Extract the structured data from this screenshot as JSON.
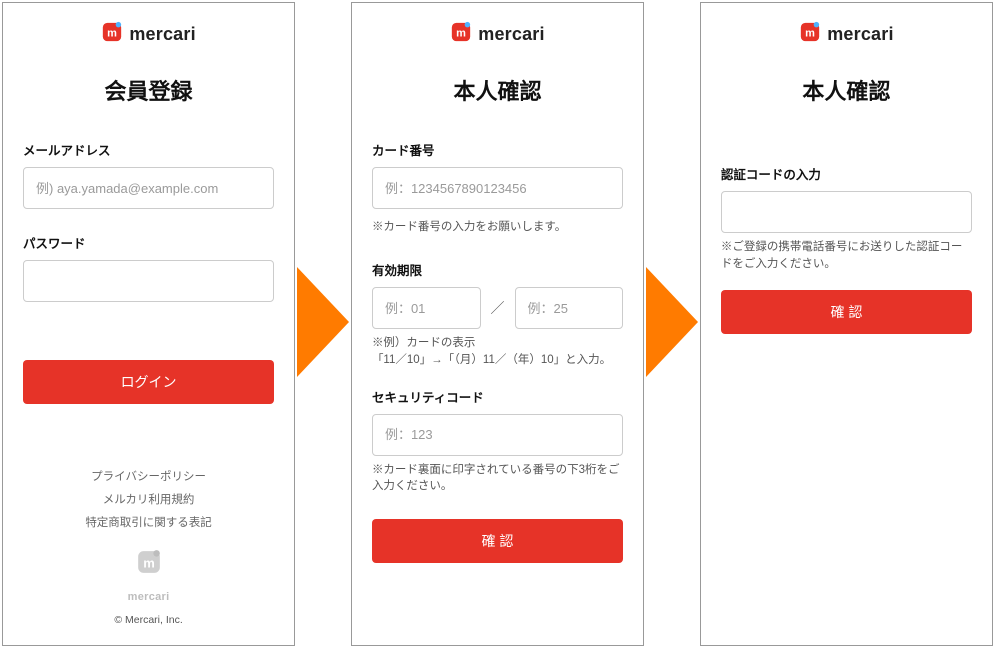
{
  "brand": {
    "name": "mercari"
  },
  "arrow_color": "#ff7b00",
  "accent": "#e63328",
  "panel1": {
    "heading": "会員登録",
    "email_label": "メールアドレス",
    "email_placeholder": "例) aya.yamada@example.com",
    "password_label": "パスワード",
    "login_btn": "ログイン",
    "links": {
      "privacy": "プライバシーポリシー",
      "terms": "メルカリ利用規約",
      "tokutei": "特定商取引に関する表記"
    },
    "copyright": "© Mercari, Inc."
  },
  "panel2": {
    "heading": "本人確認",
    "card_number_label": "カード番号",
    "card_number_placeholder": "例：1234567890123456",
    "card_number_hint": "※カード番号の入力をお願いします。",
    "expiry_label": "有効期限",
    "expiry_month_placeholder": "例：01",
    "expiry_sep": "／",
    "expiry_year_placeholder": "例：25",
    "expiry_hint": "※例）カードの表示\n「11／10」→「（月）11／（年）10」と入力。",
    "cvc_label": "セキュリティコード",
    "cvc_placeholder": "例：123",
    "cvc_hint": "※カード裏面に印字されている番号の下3桁をご入力ください。",
    "confirm_btn": "確 認"
  },
  "panel3": {
    "heading": "本人確認",
    "code_label": "認証コードの入力",
    "code_hint": "※ご登録の携帯電話番号にお送りした認証コードをご入力ください。",
    "confirm_btn": "確 認"
  }
}
